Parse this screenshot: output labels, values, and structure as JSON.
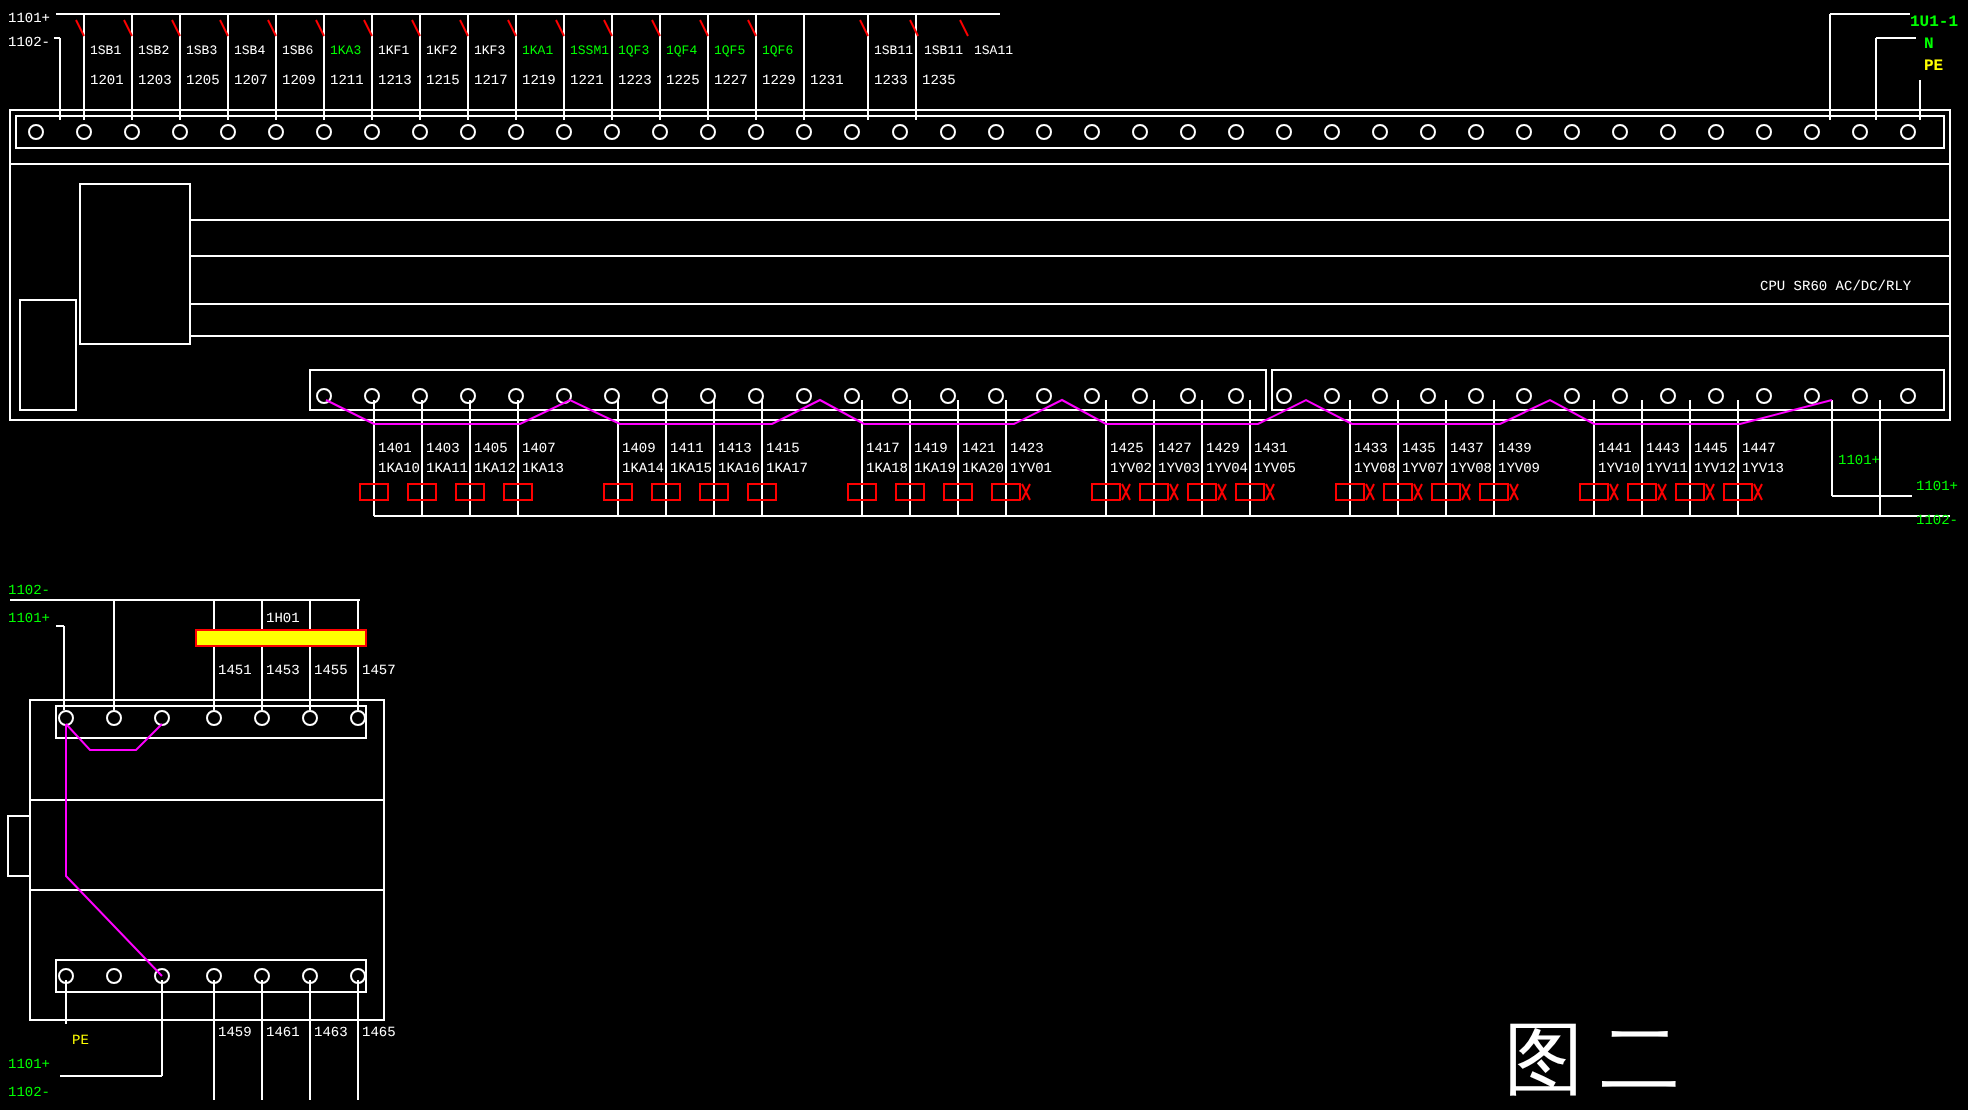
{
  "power_labels_top": [
    {
      "text": "1101+",
      "color": "#ffffff"
    },
    {
      "text": "1102-",
      "color": "#ffffff"
    }
  ],
  "switch_labels": [
    {
      "text": "1SB1",
      "color": "#ffffff"
    },
    {
      "text": "1SB2",
      "color": "#ffffff"
    },
    {
      "text": "1SB3",
      "color": "#ffffff"
    },
    {
      "text": "1SB4",
      "color": "#ffffff"
    },
    {
      "text": "1SB6",
      "color": "#ffffff"
    },
    {
      "text": "1KA3",
      "color": "#00ff00"
    },
    {
      "text": "1KF1",
      "color": "#ffffff"
    },
    {
      "text": "1KF2",
      "color": "#ffffff"
    },
    {
      "text": "1KF3",
      "color": "#ffffff"
    },
    {
      "text": "1KA1",
      "color": "#00ff00"
    },
    {
      "text": "1SSM1",
      "color": "#00ff00"
    },
    {
      "text": "1QF3",
      "color": "#00ff00"
    },
    {
      "text": "1QF4",
      "color": "#00ff00"
    },
    {
      "text": "1QF5",
      "color": "#00ff00"
    },
    {
      "text": "1QF6",
      "color": "#00ff00"
    },
    {
      "text": "1SB11",
      "color": "#ffffff"
    },
    {
      "text": "1SB11",
      "color": "#ffffff"
    },
    {
      "text": "1SA11",
      "color": "#ffffff"
    }
  ],
  "wire_numbers": [
    "1201",
    "1203",
    "1205",
    "1207",
    "1209",
    "1211",
    "1213",
    "1215",
    "1217",
    "1219",
    "1221",
    "1223",
    "1225",
    "1227",
    "1229",
    "1231",
    "1233",
    "1235"
  ],
  "supply_labels_right": [
    {
      "text": "1U1-1",
      "color": "#00ff00"
    },
    {
      "text": "N",
      "color": "#00ff00"
    },
    {
      "text": "PE",
      "color": "#ffff00"
    }
  ],
  "cpu_label": "CPU SR60 AC/DC/RLY",
  "outputs": [
    {
      "number": "1401",
      "name": "1KA10",
      "kind": "relay"
    },
    {
      "number": "1403",
      "name": "1KA11",
      "kind": "relay"
    },
    {
      "number": "1405",
      "name": "1KA12",
      "kind": "relay"
    },
    {
      "number": "1407",
      "name": "1KA13",
      "kind": "relay"
    },
    {
      "number": "1409",
      "name": "1KA14",
      "kind": "relay"
    },
    {
      "number": "1411",
      "name": "1KA15",
      "kind": "relay"
    },
    {
      "number": "1413",
      "name": "1KA16",
      "kind": "relay"
    },
    {
      "number": "1415",
      "name": "1KA17",
      "kind": "relay"
    },
    {
      "number": "1417",
      "name": "1KA18",
      "kind": "relay"
    },
    {
      "number": "1419",
      "name": "1KA19",
      "kind": "relay"
    },
    {
      "number": "1421",
      "name": "1KA20",
      "kind": "relay"
    },
    {
      "number": "1423",
      "name": "1YV01",
      "kind": "valve"
    },
    {
      "number": "1425",
      "name": "1YV02",
      "kind": "valve"
    },
    {
      "number": "1427",
      "name": "1YV03",
      "kind": "valve"
    },
    {
      "number": "1429",
      "name": "1YV04",
      "kind": "valve"
    },
    {
      "number": "1431",
      "name": "1YV05",
      "kind": "valve"
    },
    {
      "number": "1433",
      "name": "1YV08",
      "kind": "valve"
    },
    {
      "number": "1435",
      "name": "1YV07",
      "kind": "valve"
    },
    {
      "number": "1437",
      "name": "1YV08",
      "kind": "valve"
    },
    {
      "number": "1439",
      "name": "1YV09",
      "kind": "valve"
    },
    {
      "number": "1441",
      "name": "1YV10",
      "kind": "valve"
    },
    {
      "number": "1443",
      "name": "1YV11",
      "kind": "valve"
    },
    {
      "number": "1445",
      "name": "1YV12",
      "kind": "valve"
    },
    {
      "number": "1447",
      "name": "1YV13",
      "kind": "valve"
    }
  ],
  "power_labels_right": [
    {
      "text": "1101+",
      "color": "#00ff00"
    },
    {
      "text": "1101+",
      "color": "#00ff00"
    },
    {
      "text": "1102-",
      "color": "#00ff00"
    }
  ],
  "module": {
    "power_labels_top": [
      {
        "text": "1102-",
        "color": "#00ff00"
      },
      {
        "text": "1101+",
        "color": "#00ff00"
      }
    ],
    "device_label": "1H01",
    "top_numbers": [
      "1451",
      "1453",
      "1455",
      "1457"
    ],
    "bottom_numbers": [
      "1459",
      "1461",
      "1463",
      "1465"
    ],
    "pe_label": "PE",
    "power_labels_bottom": [
      {
        "text": "1101+",
        "color": "#00ff00"
      },
      {
        "text": "1102-",
        "color": "#00ff00"
      }
    ]
  },
  "caption": "图二"
}
